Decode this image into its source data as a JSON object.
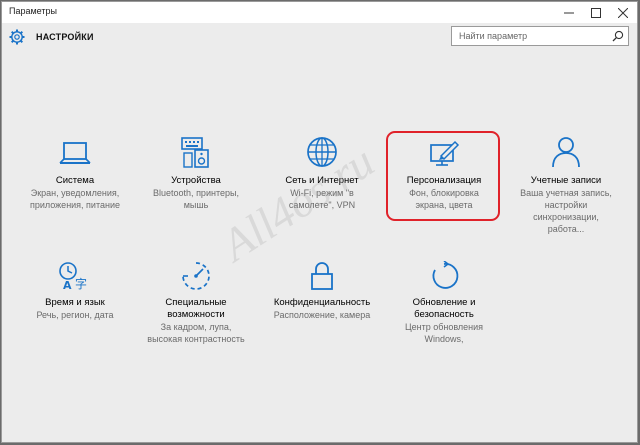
{
  "window": {
    "title": "Параметры"
  },
  "header": {
    "title": "НАСТРОЙКИ",
    "search_placeholder": "Найти параметр"
  },
  "tiles": [
    {
      "title": "Система",
      "desc1": "Экран, уведомления,",
      "desc2": "приложения, питание",
      "desc3": ""
    },
    {
      "title": "Устройства",
      "desc1": "Bluetooth, принтеры,",
      "desc2": "мышь",
      "desc3": ""
    },
    {
      "title": "Сеть и Интернет",
      "desc1": "Wi-Fi, режим \"в",
      "desc2": "самолете\", VPN",
      "desc3": ""
    },
    {
      "title": "Персонализация",
      "desc1": "Фон, блокировка",
      "desc2": "экрана, цвета",
      "desc3": ""
    },
    {
      "title": "Учетные записи",
      "desc1": "Ваша учетная запись,",
      "desc2": "настройки",
      "desc3": "синхронизации,",
      "desc4": "работа..."
    },
    {
      "title": "Время и язык",
      "desc1": "Речь, регион, дата",
      "desc2": "",
      "desc3": ""
    },
    {
      "title": "Специальные",
      "title2": "возможности",
      "desc1": "За кадром, лупа,",
      "desc2": "высокая контрастность",
      "desc3": ""
    },
    {
      "title": "Конфиденциальность",
      "desc1": "Расположение, камера",
      "desc2": "",
      "desc3": ""
    },
    {
      "title": "Обновление и",
      "title2": "безопасность",
      "desc1": "Центр обновления",
      "desc2": "Windows,",
      "desc3": ""
    }
  ],
  "watermark": "All4os.ru",
  "colors": {
    "accent": "#1a73c8",
    "highlight": "#e0222a"
  }
}
